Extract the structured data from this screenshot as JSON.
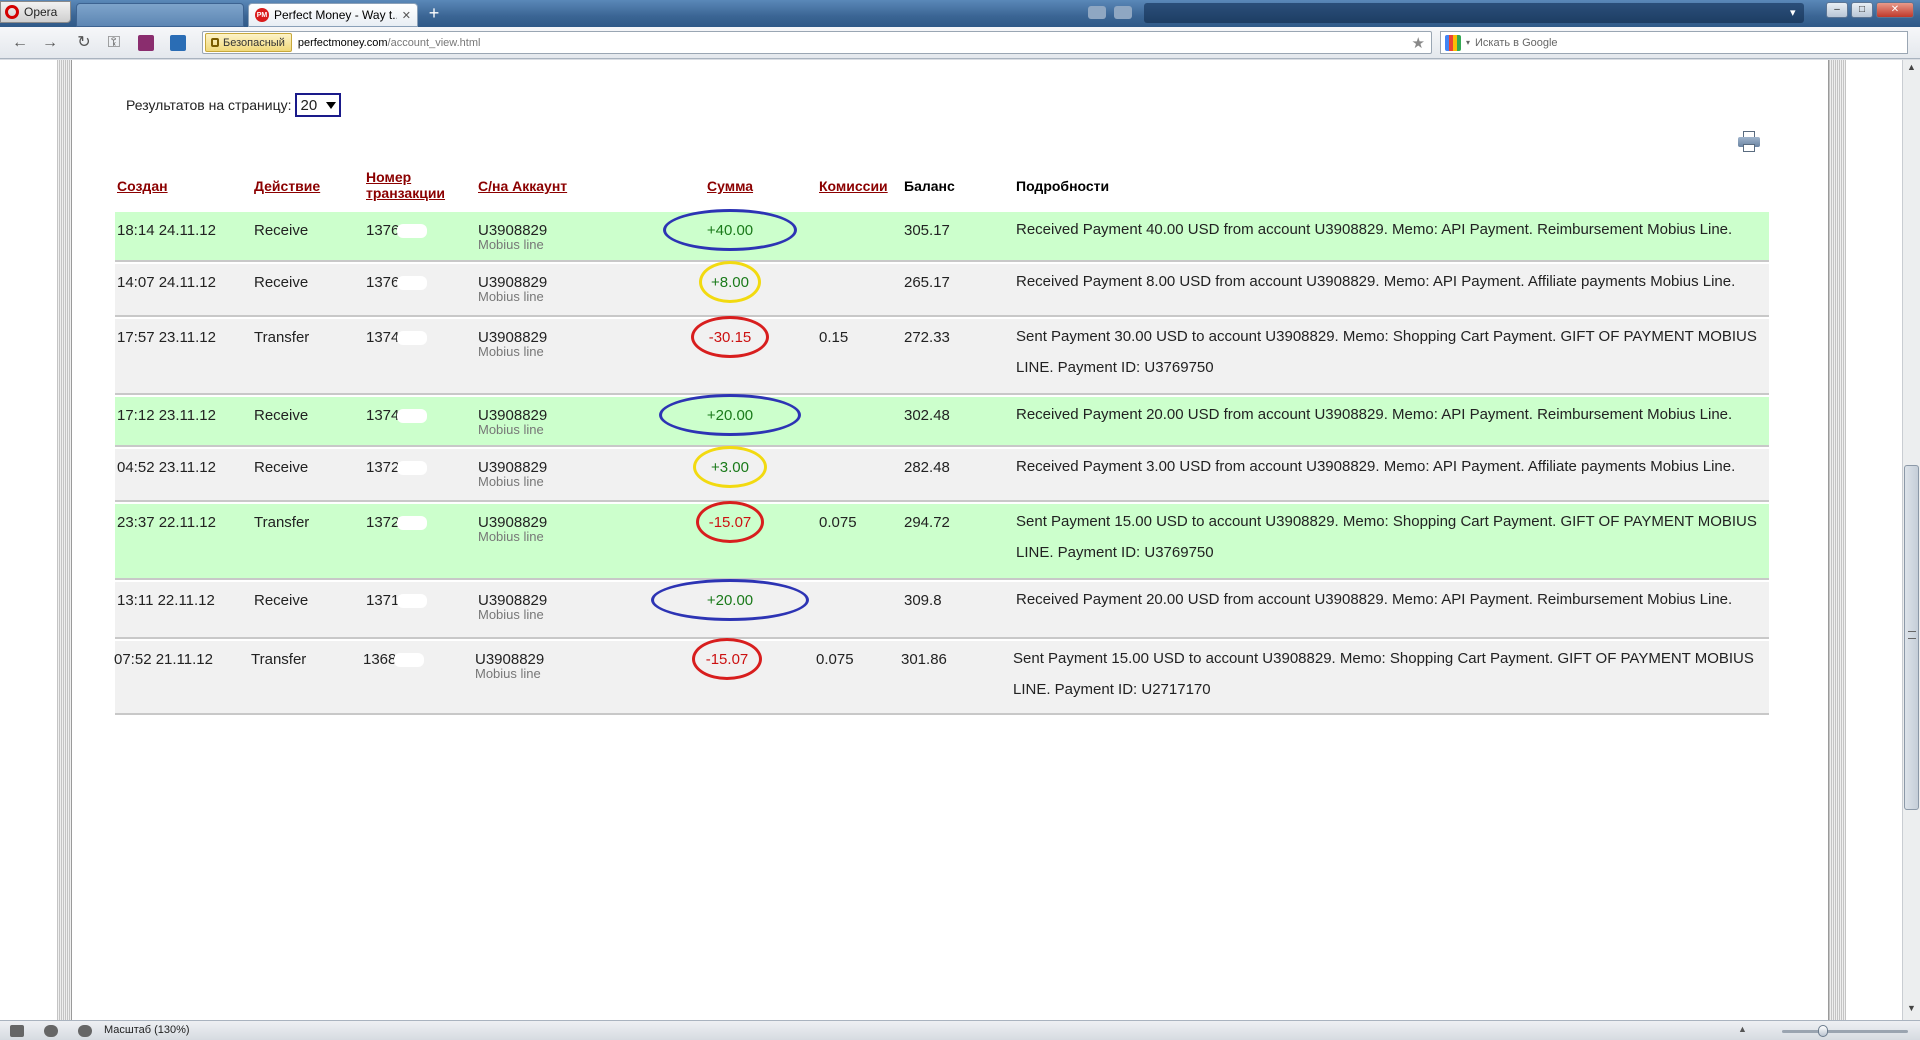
{
  "browser": {
    "menu_label": "Opera",
    "active_tab_title": "Perfect Money - Way t...",
    "active_tab_icon": "PM",
    "close_glyph": "✕",
    "new_tab_glyph": "+",
    "security_badge": "Безопасный",
    "url_host": "perfectmoney.com",
    "url_path": "/account_view.html",
    "search_placeholder": "Искать в Google"
  },
  "page": {
    "per_page_label": "Результатов на страницу:",
    "per_page_value": "20"
  },
  "table": {
    "headers": {
      "created": "Создан",
      "action": "Действие",
      "txn_line1": "Номер",
      "txn_line2": "транзакции",
      "account": "С/на Аккаунт",
      "amount": "Сумма",
      "fee": "Комиссии",
      "balance": "Баланс",
      "details": "Подробности"
    },
    "rows": [
      {
        "created": "18:14 24.11.12",
        "action": "Receive",
        "txn": "1376",
        "account": "U3908829",
        "account_name": "Mobius line",
        "amount": "+40.00",
        "fee": "",
        "balance": "305.17",
        "details": "Received Payment 40.00 USD from account U3908829. Memo: API Payment. Reimbursement Mobius Line.",
        "highlight": "blue"
      },
      {
        "created": "14:07 24.11.12",
        "action": "Receive",
        "txn": "1376",
        "account": "U3908829",
        "account_name": "Mobius line",
        "amount": "+8.00",
        "fee": "",
        "balance": "265.17",
        "details": "Received Payment 8.00 USD from account U3908829. Memo: API Payment. Affiliate payments Mobius Line.",
        "highlight": "yellow"
      },
      {
        "created": "17:57 23.11.12",
        "action": "Transfer",
        "txn": "1374",
        "account": "U3908829",
        "account_name": "Mobius line",
        "amount": "-30.15",
        "fee": "0.15",
        "balance": "272.33",
        "details": "Sent Payment 30.00 USD to account U3908829. Memo: Shopping Cart Payment. GIFT OF PAYMENT MOBIUS LINE. Payment ID: U3769750",
        "highlight": "red"
      },
      {
        "created": "17:12 23.11.12",
        "action": "Receive",
        "txn": "1374",
        "account": "U3908829",
        "account_name": "Mobius line",
        "amount": "+20.00",
        "fee": "",
        "balance": "302.48",
        "details": "Received Payment 20.00 USD from account U3908829. Memo: API Payment. Reimbursement Mobius Line.",
        "highlight": "blue"
      },
      {
        "created": "04:52 23.11.12",
        "action": "Receive",
        "txn": "1372",
        "account": "U3908829",
        "account_name": "Mobius line",
        "amount": "+3.00",
        "fee": "",
        "balance": "282.48",
        "details": "Received Payment 3.00 USD from account U3908829. Memo: API Payment. Affiliate payments Mobius Line.",
        "highlight": "yellow"
      },
      {
        "created": "23:37 22.11.12",
        "action": "Transfer",
        "txn": "1372",
        "account": "U3908829",
        "account_name": "Mobius line",
        "amount": "-15.07",
        "fee": "0.075",
        "balance": "294.72",
        "details": "Sent Payment 15.00 USD to account U3908829. Memo: Shopping Cart Payment. GIFT OF PAYMENT MOBIUS LINE. Payment ID: U3769750",
        "highlight": "red"
      },
      {
        "created": "13:11 22.11.12",
        "action": "Receive",
        "txn": "1371",
        "account": "U3908829",
        "account_name": "Mobius line",
        "amount": "+20.00",
        "fee": "",
        "balance": "309.8",
        "details": "Received Payment 20.00 USD from account U3908829. Memo: API Payment. Reimbursement Mobius Line.",
        "highlight": "blue"
      },
      {
        "created": "07:52 21.11.12",
        "action": "Transfer",
        "txn": "1368",
        "account": "U3908829",
        "account_name": "Mobius line",
        "amount": "-15.07",
        "fee": "0.075",
        "balance": "301.86",
        "details": "Sent Payment 15.00 USD to account U3908829. Memo: Shopping Cart Payment. GIFT OF PAYMENT MOBIUS LINE. Payment ID: U2717170",
        "highlight": "red"
      }
    ]
  },
  "status_bar": {
    "zoom_label": "Масштаб (130%)"
  },
  "colors": {
    "row_green": "#ccffcc",
    "row_gray": "#f1f1f1",
    "header_link": "#8b0000",
    "amount_positive": "#1a7a1a",
    "amount_negative": "#cc1111",
    "oval_blue": "#2d34b4",
    "oval_yellow": "#f2da10",
    "oval_red": "#d81e1e"
  }
}
